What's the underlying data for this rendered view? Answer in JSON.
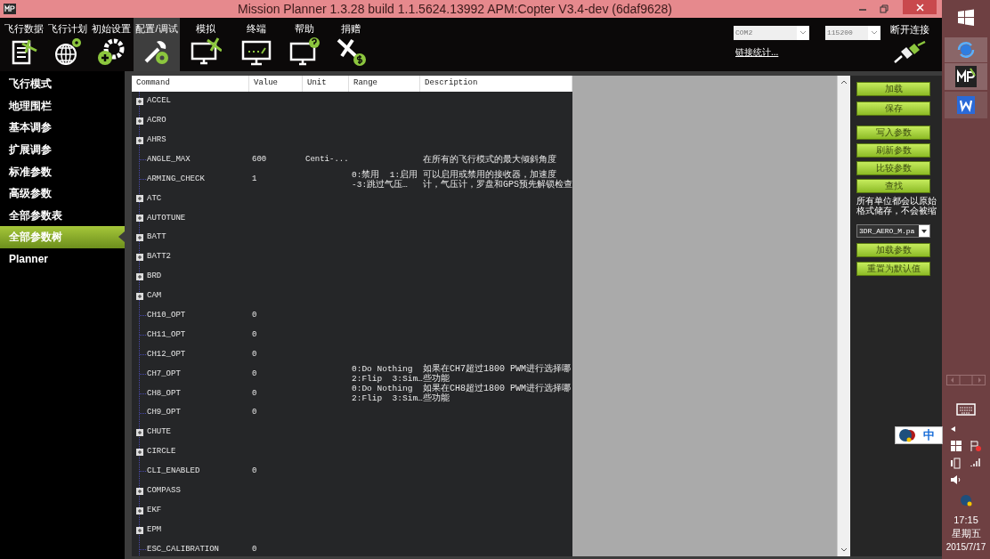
{
  "window": {
    "title": "Mission Planner 1.3.28 build 1.1.5624.13992 APM:Copter V3.4-dev (6daf9628)"
  },
  "menu": [
    {
      "label": "飞行数据",
      "selected": false
    },
    {
      "label": "飞行计划",
      "selected": false
    },
    {
      "label": "初始设置",
      "selected": false
    },
    {
      "label": "配置/调试",
      "selected": true
    },
    {
      "label": "模拟",
      "selected": false
    },
    {
      "label": "终端",
      "selected": false
    },
    {
      "label": "帮助",
      "selected": false
    },
    {
      "label": "捐赠",
      "selected": false
    }
  ],
  "connection": {
    "port": "COM2",
    "baud": "115200",
    "stats_link": "链接统计...",
    "connect_label": "断开连接"
  },
  "sidebar": {
    "items": [
      {
        "label": "飞行模式",
        "selected": false
      },
      {
        "label": "地理围栏",
        "selected": false
      },
      {
        "label": "基本调参",
        "selected": false
      },
      {
        "label": "扩展调参",
        "selected": false
      },
      {
        "label": "标准参数",
        "selected": false
      },
      {
        "label": "高级参数",
        "selected": false
      },
      {
        "label": "全部参数表",
        "selected": false
      },
      {
        "label": "全部参数树",
        "selected": true
      },
      {
        "label": "Planner",
        "selected": false
      }
    ]
  },
  "table": {
    "columns": [
      "Command",
      "Value",
      "Unit",
      "Range",
      "Description"
    ],
    "rows": [
      {
        "kind": "group",
        "command": "ACCEL",
        "expanded": false
      },
      {
        "kind": "group",
        "command": "ACRO",
        "expanded": false
      },
      {
        "kind": "group",
        "command": "AHRS",
        "expanded": false
      },
      {
        "kind": "param",
        "command": "ANGLE_MAX",
        "value": "600",
        "unit": "Centi-...",
        "description": "在所有的飞行模式的最大倾斜角度"
      },
      {
        "kind": "param",
        "command": "ARMING_CHECK",
        "value": "1",
        "range": "0:禁用  1:启用\n-3:跳过气压…",
        "description": "可以启用或禁用的接收器，加速度计，气压计，罗盘和GPS预先解锁检查"
      },
      {
        "kind": "group",
        "command": "ATC",
        "expanded": false
      },
      {
        "kind": "group",
        "command": "AUTOTUNE",
        "expanded": false
      },
      {
        "kind": "group",
        "command": "BATT",
        "expanded": false
      },
      {
        "kind": "group",
        "command": "BATT2",
        "expanded": false
      },
      {
        "kind": "group",
        "command": "BRD",
        "expanded": false
      },
      {
        "kind": "group",
        "command": "CAM",
        "expanded": false
      },
      {
        "kind": "param",
        "command": "CH10_OPT",
        "value": "0"
      },
      {
        "kind": "param",
        "command": "CH11_OPT",
        "value": "0"
      },
      {
        "kind": "param",
        "command": "CH12_OPT",
        "value": "0"
      },
      {
        "kind": "param",
        "command": "CH7_OPT",
        "value": "0",
        "range": "0:Do Nothing\n2:Flip  3:Sim…",
        "description": "如果在CH7超过1800 PWM进行选择哪些功能"
      },
      {
        "kind": "param",
        "command": "CH8_OPT",
        "value": "0",
        "range": "0:Do Nothing\n2:Flip  3:Sim…",
        "description": "如果在CH8超过1800 PWM进行选择哪些功能"
      },
      {
        "kind": "param",
        "command": "CH9_OPT",
        "value": "0"
      },
      {
        "kind": "group",
        "command": "CHUTE",
        "expanded": false
      },
      {
        "kind": "group",
        "command": "CIRCLE",
        "expanded": false
      },
      {
        "kind": "param",
        "command": "CLI_ENABLED",
        "value": "0"
      },
      {
        "kind": "group",
        "command": "COMPASS",
        "expanded": false
      },
      {
        "kind": "group",
        "command": "EKF",
        "expanded": false
      },
      {
        "kind": "group",
        "command": "EPM",
        "expanded": false
      },
      {
        "kind": "param",
        "command": "ESC_CALIBRATION",
        "value": "0"
      }
    ]
  },
  "actions": {
    "top": [
      "加载",
      "保存"
    ],
    "middle": [
      "写入参数",
      "刷新参数",
      "比较参数",
      "查找"
    ],
    "note": "所有单位都会以原始格式储存，不会被缩",
    "param_file": "3DR_AERO_M.pa",
    "bottom": [
      "加载参数",
      "重置为默认值"
    ]
  },
  "ime": {
    "mode": "中"
  },
  "taskbar": {
    "time": "17:15",
    "weekday": "星期五",
    "date": "2015/7/17"
  }
}
